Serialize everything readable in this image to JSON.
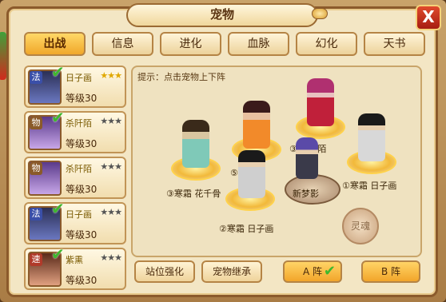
{
  "window": {
    "title": "宠物",
    "close_label": "X"
  },
  "tabs": [
    {
      "label": "出战",
      "active": true
    },
    {
      "label": "信息"
    },
    {
      "label": "进化"
    },
    {
      "label": "血脉"
    },
    {
      "label": "幻化"
    },
    {
      "label": "天书"
    }
  ],
  "pets": [
    {
      "badge": "法",
      "name": "日子画",
      "stars": "★★★",
      "level": "等级30",
      "deployed": true,
      "check": "✔"
    },
    {
      "badge": "物",
      "name": "杀阡陌",
      "stars": "★★★",
      "level": "等级30",
      "deployed": true,
      "check": "✔"
    },
    {
      "badge": "物",
      "name": "杀阡陌",
      "stars": "★★★",
      "level": "等级30",
      "deployed": false,
      "check": ""
    },
    {
      "badge": "法",
      "name": "日子画",
      "stars": "★★★",
      "level": "等级30",
      "deployed": true,
      "check": "✔"
    },
    {
      "badge": "速",
      "name": "紫熏",
      "stars": "★★★",
      "level": "等级30",
      "deployed": true,
      "check": "✔"
    }
  ],
  "stage": {
    "hint": "提示：点击宠物上下阵",
    "slots": [
      {
        "label": "③寒霜  花千骨"
      },
      {
        "label": "⑤   紫熏"
      },
      {
        "label": "③   杀阡陌"
      },
      {
        "label": "②寒霜   日子画"
      },
      {
        "label": "①寒霜   日子画"
      }
    ],
    "empty_slot_name": "新梦影",
    "stamp_text": "灵魂"
  },
  "buttons": {
    "enhance": "站位强化",
    "inherit": "宠物继承",
    "formation_a": "A   阵",
    "formation_b": "B   阵",
    "active_check": "✔"
  },
  "colors": {
    "accent": "#f2a52a",
    "check": "#3fb82e",
    "badge_magic": "#3a4fa8",
    "badge_physical": "#8a5a2a",
    "badge_speed": "#b03a2a"
  }
}
